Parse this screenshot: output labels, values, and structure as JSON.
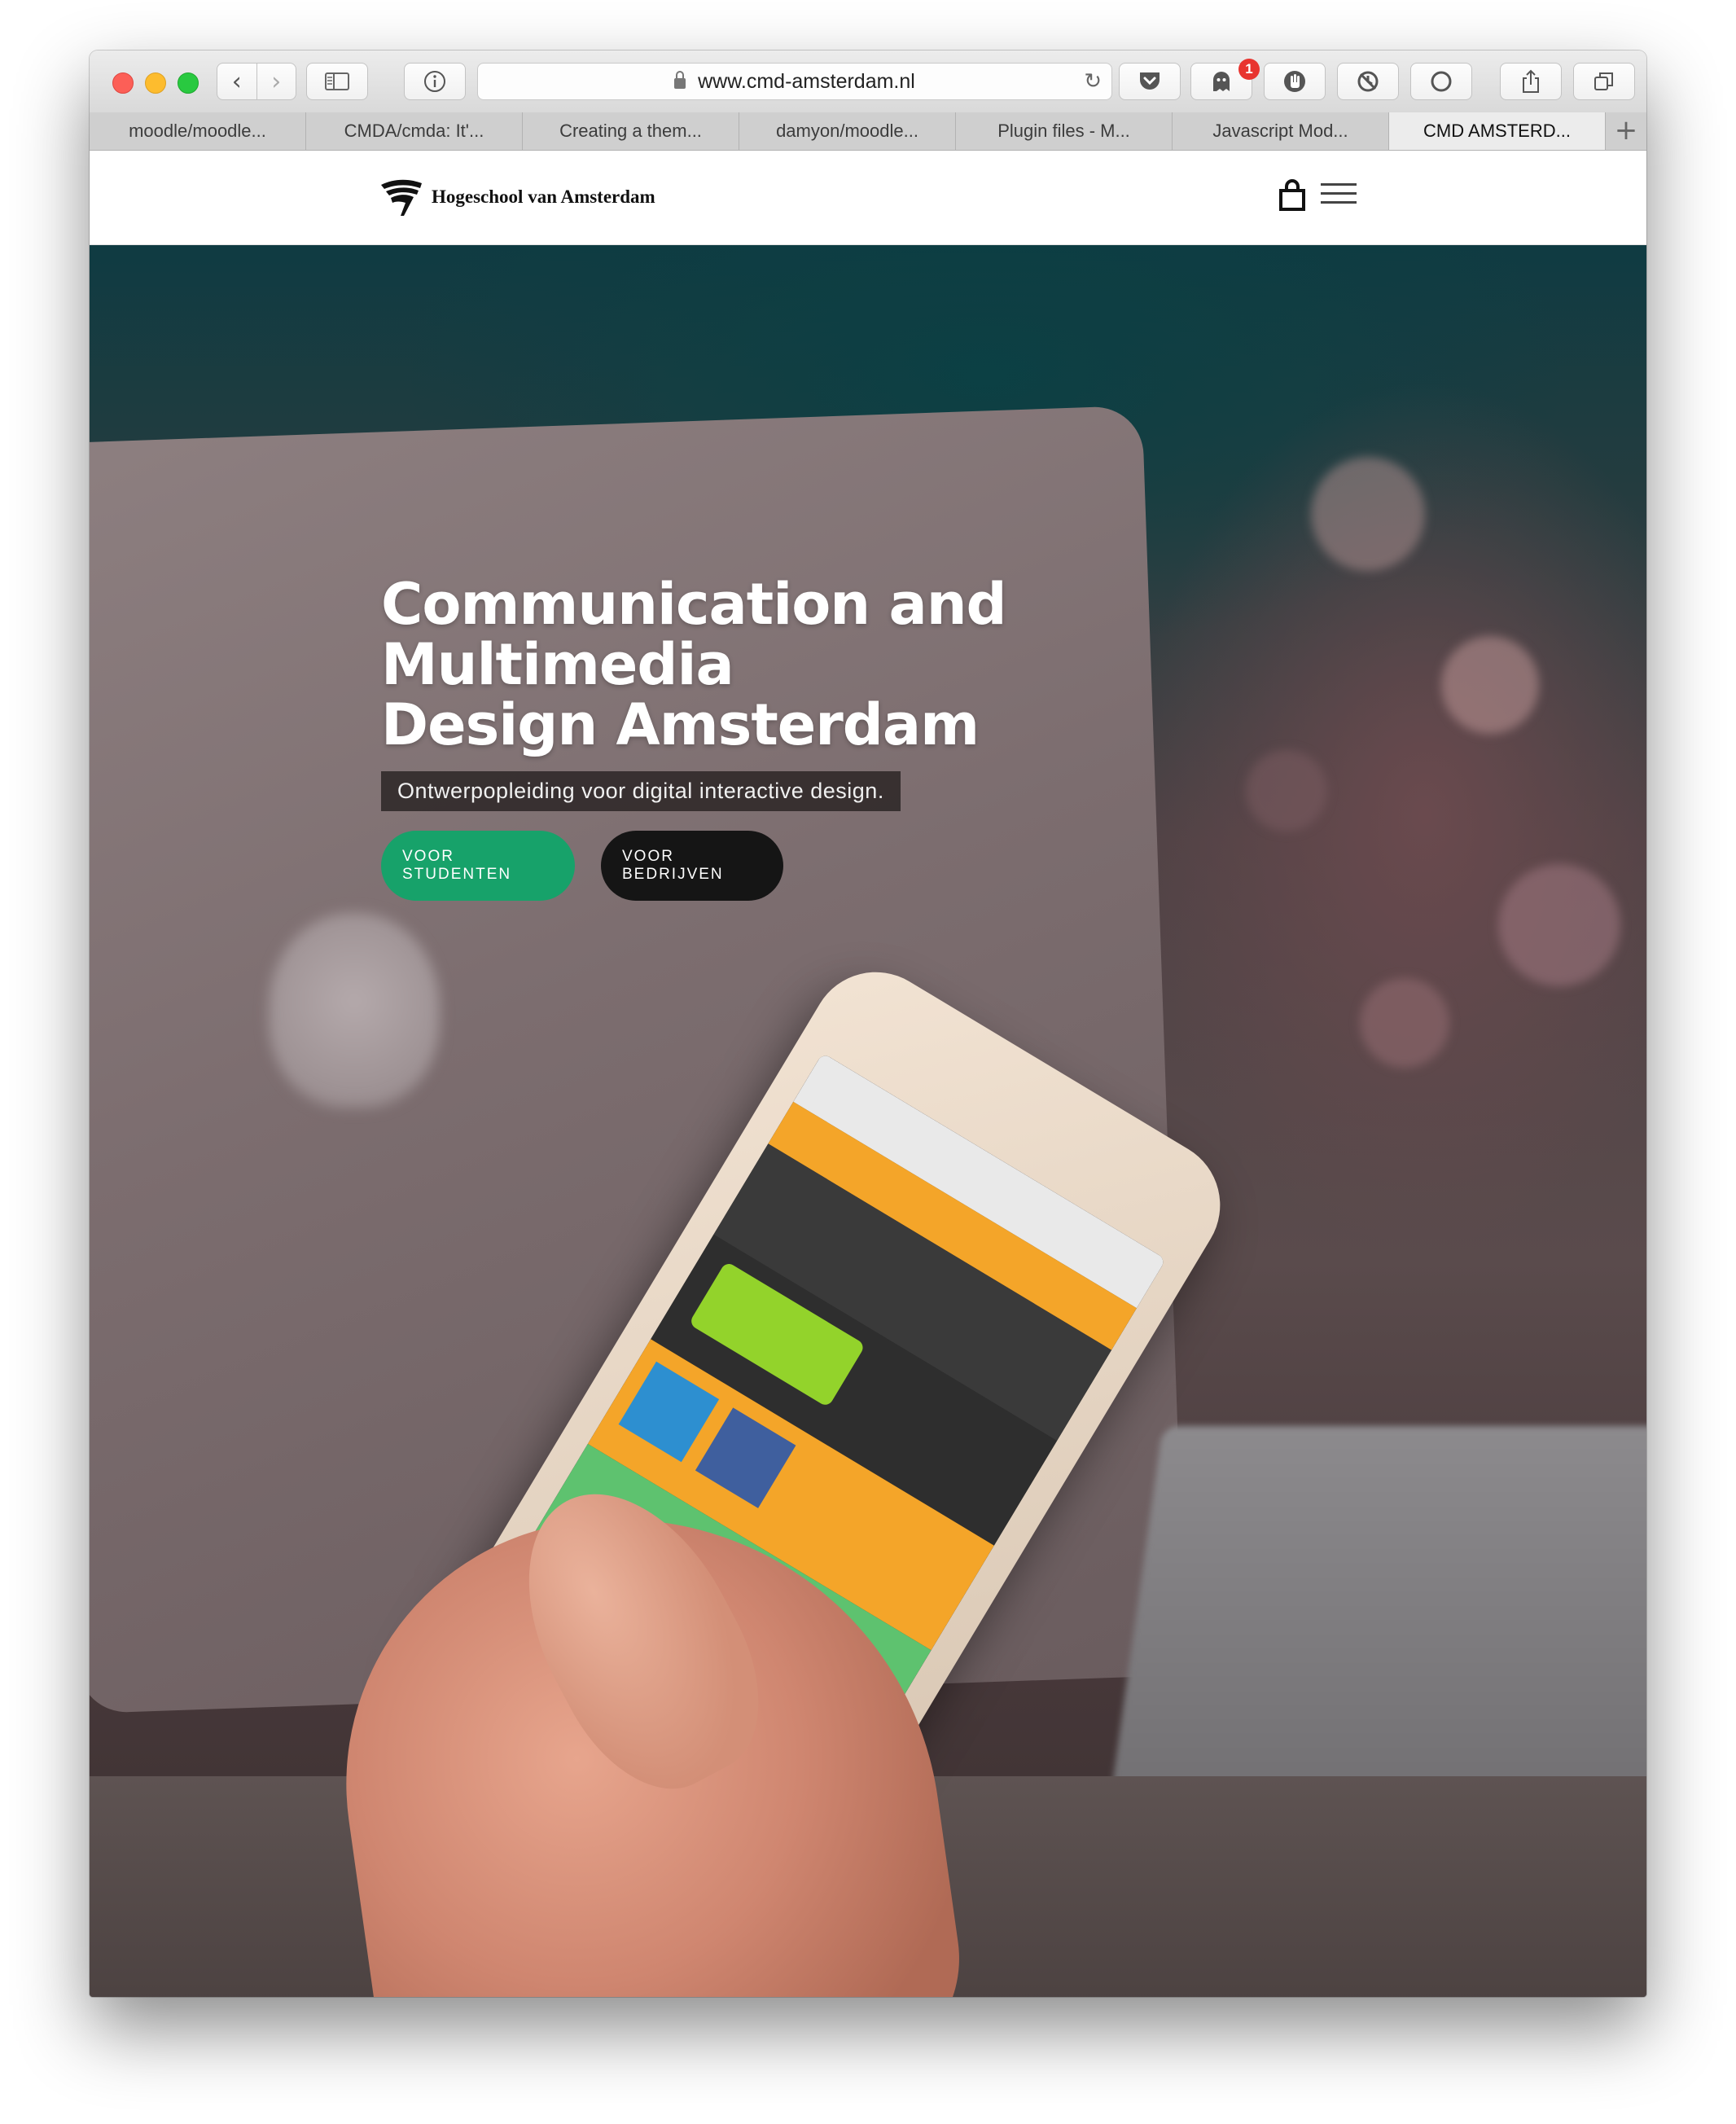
{
  "browser": {
    "url": "www.cmd-amsterdam.nl",
    "notification_count": "1",
    "tabs": [
      {
        "label": "moodle/moodle...",
        "active": false
      },
      {
        "label": "CMDA/cmda: It'...",
        "active": false
      },
      {
        "label": "Creating a them...",
        "active": false
      },
      {
        "label": "damyon/moodle...",
        "active": false
      },
      {
        "label": "Plugin files - M...",
        "active": false
      },
      {
        "label": "Javascript Mod...",
        "active": false
      },
      {
        "label": "CMD AMSTERD...",
        "active": true
      }
    ]
  },
  "header": {
    "logo_text": "Hogeschool van Amsterdam"
  },
  "hero": {
    "title_line1": "Communication and Multimedia",
    "title_line2": "Design Amsterdam",
    "subtitle": "Ontwerpopleiding voor digital interactive design.",
    "button_students": "VOOR STUDENTEN",
    "button_companies": "VOOR BEDRIJVEN"
  },
  "colors": {
    "accent_green": "#17a26a",
    "button_dark": "#151515"
  }
}
